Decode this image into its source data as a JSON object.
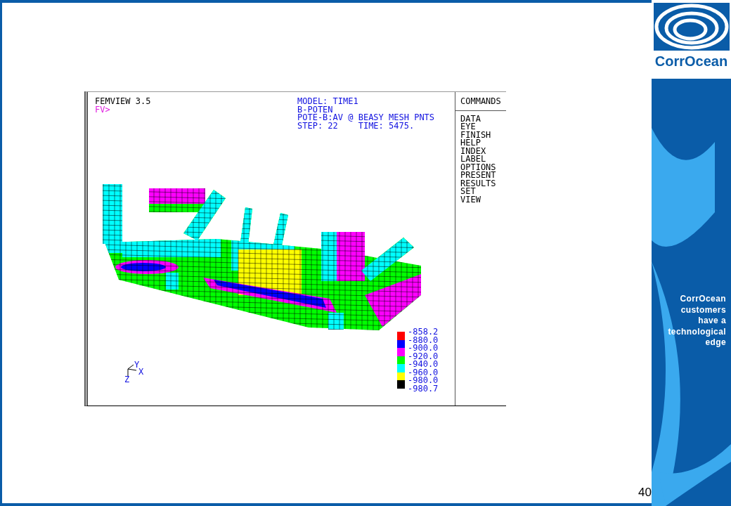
{
  "screen": {
    "title": "FEMVIEW 3.5",
    "prompt": "FV>",
    "info": [
      "MODEL: TIME1",
      "B-POTEN",
      "POTE-B:AV @ BEASY MESH PNTS",
      "STEP: 22    TIME: 5475."
    ],
    "commands_title": "COMMANDS",
    "commands": [
      "DATA",
      "EYE",
      "FINISH",
      "HELP",
      "INDEX",
      "LABEL",
      "OPTIONS",
      "PRESENT",
      "RESULTS",
      "SET",
      "VIEW"
    ],
    "legend": {
      "labels": [
        "-858.2",
        "-880.0",
        "-900.0",
        "-920.0",
        "-940.0",
        "-960.0",
        "-980.0",
        "-980.7"
      ],
      "swatches": [
        {
          "color": "#ff0000"
        },
        {
          "color": "#0000ff"
        },
        {
          "color": "#ff00ff"
        },
        {
          "color": "#00ff00"
        },
        {
          "color": "#00ffff"
        },
        {
          "color": "#ffff00"
        },
        {
          "color": "#000000"
        }
      ]
    },
    "axes": {
      "y": "Y",
      "x": "X",
      "z": "Z"
    }
  },
  "brand": {
    "logo_text": "CorrOcean",
    "tagline": [
      "CorrOcean",
      "customers",
      "have a",
      "technological",
      "edge"
    ]
  },
  "slide_number": "40"
}
